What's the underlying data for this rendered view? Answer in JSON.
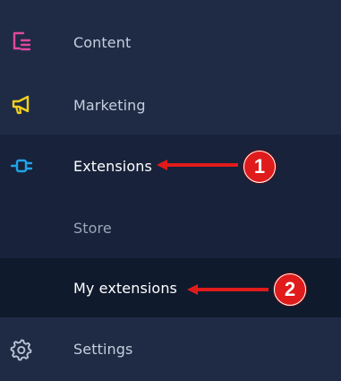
{
  "menu": {
    "items": [
      {
        "label": "Content",
        "icon": "content-icon",
        "icon_color": "#e0489e"
      },
      {
        "label": "Marketing",
        "icon": "megaphone-icon",
        "icon_color": "#f2d01c"
      },
      {
        "label": "Extensions",
        "icon": "plug-icon",
        "icon_color": "#1fa4e8",
        "active": true
      },
      {
        "label": "Settings",
        "icon": "gear-icon",
        "icon_color": "#b8c2d2"
      }
    ],
    "sub_items": [
      {
        "label": "Store"
      },
      {
        "label": "My extensions",
        "active": true
      }
    ]
  },
  "annotations": [
    {
      "number": "1",
      "target": "Extensions",
      "color": "#e01b1b"
    },
    {
      "number": "2",
      "target": "My extensions",
      "color": "#e01b1b"
    }
  ]
}
